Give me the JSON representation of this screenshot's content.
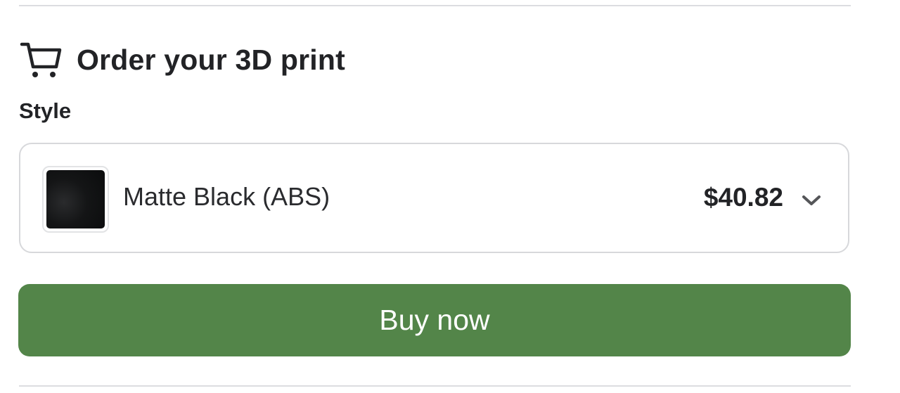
{
  "order": {
    "title": "Order your 3D print",
    "icon": "shopping-cart-icon"
  },
  "style": {
    "label": "Style",
    "selected": {
      "name": "Matte Black (ABS)",
      "price": "$40.82",
      "swatch_color": "#111213"
    },
    "dropdown_icon": "chevron-down-icon"
  },
  "actions": {
    "buy_label": "Buy now",
    "buy_color": "#538549"
  }
}
